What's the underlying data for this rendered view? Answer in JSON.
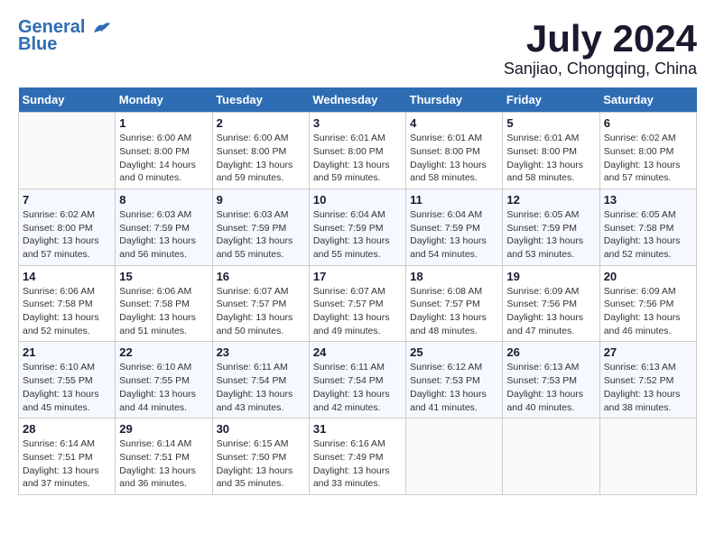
{
  "header": {
    "logo": {
      "line1": "General",
      "line2": "Blue"
    },
    "month": "July 2024",
    "location": "Sanjiao, Chongqing, China"
  },
  "columns": [
    "Sunday",
    "Monday",
    "Tuesday",
    "Wednesday",
    "Thursday",
    "Friday",
    "Saturday"
  ],
  "weeks": [
    [
      {
        "day": "",
        "info": ""
      },
      {
        "day": "1",
        "info": "Sunrise: 6:00 AM\nSunset: 8:00 PM\nDaylight: 14 hours\nand 0 minutes."
      },
      {
        "day": "2",
        "info": "Sunrise: 6:00 AM\nSunset: 8:00 PM\nDaylight: 13 hours\nand 59 minutes."
      },
      {
        "day": "3",
        "info": "Sunrise: 6:01 AM\nSunset: 8:00 PM\nDaylight: 13 hours\nand 59 minutes."
      },
      {
        "day": "4",
        "info": "Sunrise: 6:01 AM\nSunset: 8:00 PM\nDaylight: 13 hours\nand 58 minutes."
      },
      {
        "day": "5",
        "info": "Sunrise: 6:01 AM\nSunset: 8:00 PM\nDaylight: 13 hours\nand 58 minutes."
      },
      {
        "day": "6",
        "info": "Sunrise: 6:02 AM\nSunset: 8:00 PM\nDaylight: 13 hours\nand 57 minutes."
      }
    ],
    [
      {
        "day": "7",
        "info": "Sunrise: 6:02 AM\nSunset: 8:00 PM\nDaylight: 13 hours\nand 57 minutes."
      },
      {
        "day": "8",
        "info": "Sunrise: 6:03 AM\nSunset: 7:59 PM\nDaylight: 13 hours\nand 56 minutes."
      },
      {
        "day": "9",
        "info": "Sunrise: 6:03 AM\nSunset: 7:59 PM\nDaylight: 13 hours\nand 55 minutes."
      },
      {
        "day": "10",
        "info": "Sunrise: 6:04 AM\nSunset: 7:59 PM\nDaylight: 13 hours\nand 55 minutes."
      },
      {
        "day": "11",
        "info": "Sunrise: 6:04 AM\nSunset: 7:59 PM\nDaylight: 13 hours\nand 54 minutes."
      },
      {
        "day": "12",
        "info": "Sunrise: 6:05 AM\nSunset: 7:59 PM\nDaylight: 13 hours\nand 53 minutes."
      },
      {
        "day": "13",
        "info": "Sunrise: 6:05 AM\nSunset: 7:58 PM\nDaylight: 13 hours\nand 52 minutes."
      }
    ],
    [
      {
        "day": "14",
        "info": "Sunrise: 6:06 AM\nSunset: 7:58 PM\nDaylight: 13 hours\nand 52 minutes."
      },
      {
        "day": "15",
        "info": "Sunrise: 6:06 AM\nSunset: 7:58 PM\nDaylight: 13 hours\nand 51 minutes."
      },
      {
        "day": "16",
        "info": "Sunrise: 6:07 AM\nSunset: 7:57 PM\nDaylight: 13 hours\nand 50 minutes."
      },
      {
        "day": "17",
        "info": "Sunrise: 6:07 AM\nSunset: 7:57 PM\nDaylight: 13 hours\nand 49 minutes."
      },
      {
        "day": "18",
        "info": "Sunrise: 6:08 AM\nSunset: 7:57 PM\nDaylight: 13 hours\nand 48 minutes."
      },
      {
        "day": "19",
        "info": "Sunrise: 6:09 AM\nSunset: 7:56 PM\nDaylight: 13 hours\nand 47 minutes."
      },
      {
        "day": "20",
        "info": "Sunrise: 6:09 AM\nSunset: 7:56 PM\nDaylight: 13 hours\nand 46 minutes."
      }
    ],
    [
      {
        "day": "21",
        "info": "Sunrise: 6:10 AM\nSunset: 7:55 PM\nDaylight: 13 hours\nand 45 minutes."
      },
      {
        "day": "22",
        "info": "Sunrise: 6:10 AM\nSunset: 7:55 PM\nDaylight: 13 hours\nand 44 minutes."
      },
      {
        "day": "23",
        "info": "Sunrise: 6:11 AM\nSunset: 7:54 PM\nDaylight: 13 hours\nand 43 minutes."
      },
      {
        "day": "24",
        "info": "Sunrise: 6:11 AM\nSunset: 7:54 PM\nDaylight: 13 hours\nand 42 minutes."
      },
      {
        "day": "25",
        "info": "Sunrise: 6:12 AM\nSunset: 7:53 PM\nDaylight: 13 hours\nand 41 minutes."
      },
      {
        "day": "26",
        "info": "Sunrise: 6:13 AM\nSunset: 7:53 PM\nDaylight: 13 hours\nand 40 minutes."
      },
      {
        "day": "27",
        "info": "Sunrise: 6:13 AM\nSunset: 7:52 PM\nDaylight: 13 hours\nand 38 minutes."
      }
    ],
    [
      {
        "day": "28",
        "info": "Sunrise: 6:14 AM\nSunset: 7:51 PM\nDaylight: 13 hours\nand 37 minutes."
      },
      {
        "day": "29",
        "info": "Sunrise: 6:14 AM\nSunset: 7:51 PM\nDaylight: 13 hours\nand 36 minutes."
      },
      {
        "day": "30",
        "info": "Sunrise: 6:15 AM\nSunset: 7:50 PM\nDaylight: 13 hours\nand 35 minutes."
      },
      {
        "day": "31",
        "info": "Sunrise: 6:16 AM\nSunset: 7:49 PM\nDaylight: 13 hours\nand 33 minutes."
      },
      {
        "day": "",
        "info": ""
      },
      {
        "day": "",
        "info": ""
      },
      {
        "day": "",
        "info": ""
      }
    ]
  ]
}
